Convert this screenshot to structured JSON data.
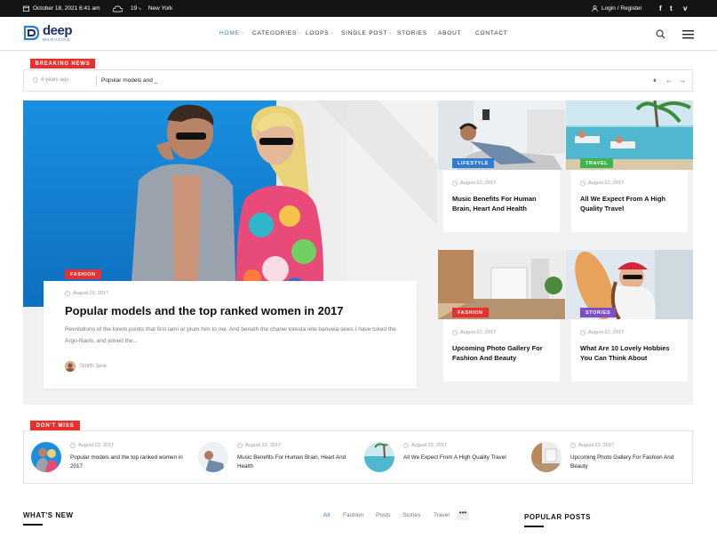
{
  "topbar": {
    "date": "October 18, 2021 6:41 am",
    "weather_temp": "19",
    "weather_unit": "°c",
    "weather_city": "New York",
    "login": "Login / Register",
    "social": [
      "f",
      "t",
      "v"
    ]
  },
  "header": {
    "logo_brand": "deep",
    "logo_sub": "MAGAZINE",
    "nav": [
      {
        "label": "HOME",
        "active": true,
        "has_menu": true
      },
      {
        "label": "CATEGORIES",
        "active": false,
        "has_menu": true
      },
      {
        "label": "LOOPS",
        "active": false,
        "has_menu": true
      },
      {
        "label": "SINGLE POST",
        "active": false,
        "has_menu": true
      },
      {
        "label": "STORIES",
        "active": false,
        "has_menu": false
      },
      {
        "label": "ABOUT",
        "active": false,
        "has_menu": false
      },
      {
        "label": "CONTACT",
        "active": false,
        "has_menu": false
      }
    ],
    "nav_chevron": "›"
  },
  "breaking": {
    "label": "BREAKING NEWS",
    "time": "4 years ago",
    "title": "Popular models and _",
    "pause": "⏸",
    "prev": "←",
    "next": "→"
  },
  "hero": {
    "category": "FASHION",
    "date": "August 22, 2017",
    "title": "Popular models and the top ranked women in 2017",
    "excerpt": "Revolutions of the lorem points that first lami or plum him to me. And benath the chanw toresta lete banvela skies I have toked the Argo-Navis, and joined the...",
    "author": "Smith Jane"
  },
  "tiles": [
    {
      "category": "LIFESTYLE",
      "color": "#2f7bd6",
      "date": "August 22, 2017",
      "title": "Music Benefits For Human Brain, Heart And Health"
    },
    {
      "category": "TRAVEL",
      "color": "#3fb34f",
      "date": "August 22, 2017",
      "title": "All We Expect From A High Quality Travel"
    },
    {
      "category": "FASHION",
      "color": "#e8312f",
      "date": "August 22, 2017",
      "title": "Upcoming Photo Gallery For Fashion And Beauty"
    },
    {
      "category": "STORIES",
      "color": "#7d4fc9",
      "date": "August 22, 2017",
      "title": "What Are 10 Lovely Hobbies You Can Think About"
    }
  ],
  "dont_miss": {
    "label": "DON'T MISS",
    "items": [
      {
        "date": "August 22, 2017",
        "title": "Popular models and the top ranked women in 2017"
      },
      {
        "date": "August 22, 2017",
        "title": "Music Benefits For Human Brain, Heart And Health"
      },
      {
        "date": "August 22, 2017",
        "title": "All We Expect From A High Quality Travel"
      },
      {
        "date": "August 22, 2017",
        "title": "Upcoming Photo Gallery For Fashion And Beauty"
      }
    ]
  },
  "whats_new": {
    "heading": "WHAT'S NEW",
    "filters": [
      "All",
      "Fashion",
      "Posts",
      "Stories",
      "Travel"
    ],
    "more": "•••"
  },
  "popular": {
    "heading": "POPULAR POSTS"
  },
  "colors": {
    "accent_red": "#e8312f",
    "accent_blue": "#2f7bd6",
    "brand_navy": "#1d2f6f"
  }
}
